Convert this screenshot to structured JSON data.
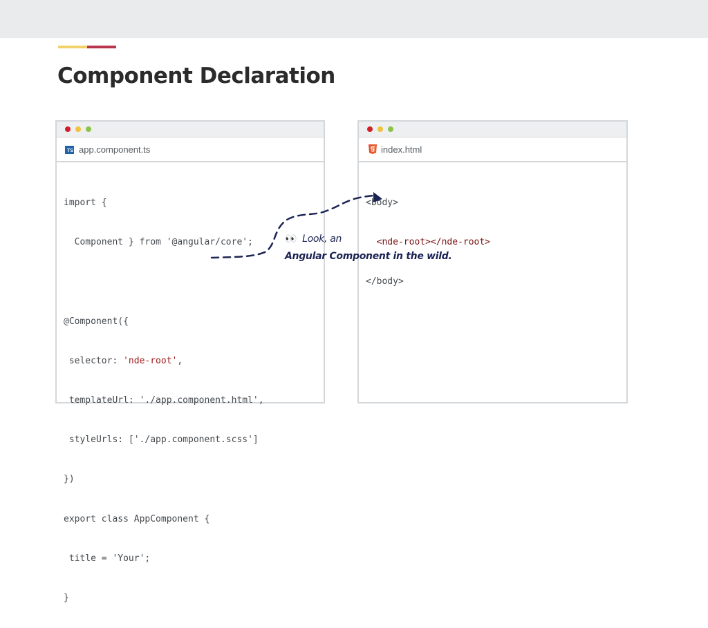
{
  "slide": {
    "title": "Component Declaration"
  },
  "colors": {
    "accent_yellow": "#f1d26a",
    "accent_red": "#b8354e",
    "annotation_ink": "#1c2454"
  },
  "left_window": {
    "tab_icon": "typescript-icon",
    "ts_badge": "TS",
    "filename": "app.component.ts",
    "code_lines": [
      "import {",
      "  Component } from '@angular/core';",
      "",
      "@Component({",
      " selector: ",
      " templateUrl: './app.component.html',",
      " styleUrls: ['./app.component.scss']",
      "})",
      "export class AppComponent {",
      " title = 'Your';",
      "}"
    ],
    "selector_value": "'nde-root'",
    "selector_suffix": ","
  },
  "right_window": {
    "tab_icon": "html5-icon",
    "filename": "index.html",
    "code_lines": [
      "<body>",
      "  <nde-root></nde-root>",
      "</body>"
    ]
  },
  "annotation": {
    "eyes": "👀",
    "line1": "Look, an",
    "line2": "Angular Component in the wild."
  }
}
